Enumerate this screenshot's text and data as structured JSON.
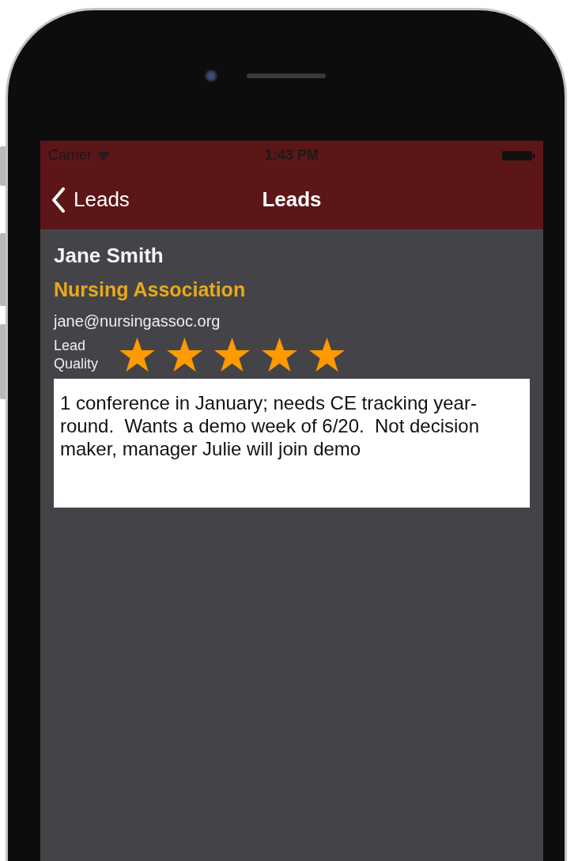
{
  "status_bar": {
    "carrier": "Carrier",
    "time": "1:43 PM"
  },
  "nav_bar": {
    "back_label": "Leads",
    "title": "Leads"
  },
  "lead": {
    "name": "Jane Smith",
    "organization": "Nursing Association",
    "email": "jane@nursingassoc.org",
    "quality_label": "Lead Quality",
    "stars": 5,
    "notes": "1 conference in January; needs CE tracking year-round.  Wants a demo week of 6/20.  Not decision maker, manager Julie will join demo"
  }
}
